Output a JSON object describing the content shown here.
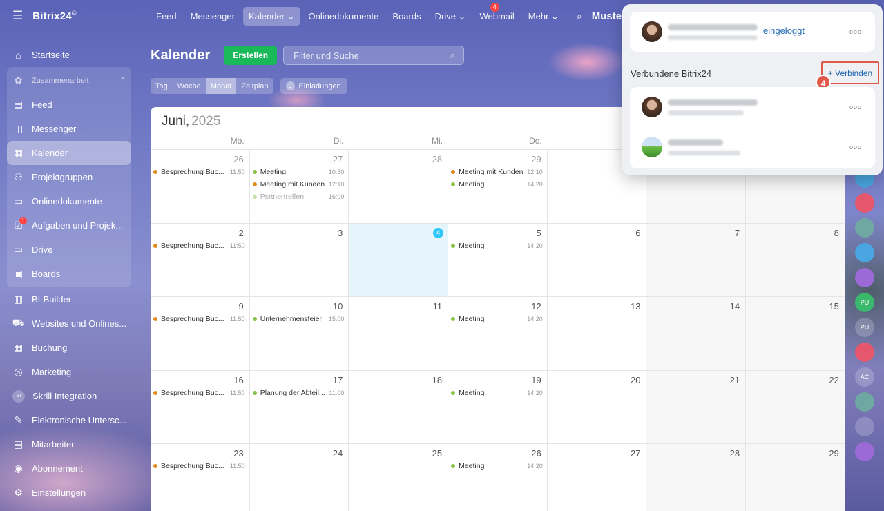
{
  "sidebar": {
    "logo": "Bitrix24",
    "logo_mark": "©",
    "items": [
      {
        "label": "Startseite",
        "icon": "home-icon"
      },
      {
        "label": "Zusammenarbeit",
        "icon": "collab-icon",
        "group_header": true
      },
      {
        "label": "Feed",
        "icon": "feed-icon"
      },
      {
        "label": "Messenger",
        "icon": "messenger-icon"
      },
      {
        "label": "Kalender",
        "icon": "calendar-icon",
        "active": true
      },
      {
        "label": "Projektgruppen",
        "icon": "groups-icon"
      },
      {
        "label": "Onlinedokumente",
        "icon": "document-icon"
      },
      {
        "label": "Aufgaben und Projek...",
        "icon": "tasks-icon",
        "badge": "1"
      },
      {
        "label": "Drive",
        "icon": "drive-icon"
      },
      {
        "label": "Boards",
        "icon": "boards-icon"
      },
      {
        "label": "BI-Builder",
        "icon": "chart-icon"
      },
      {
        "label": "Websites und Onlines...",
        "icon": "cart-icon"
      },
      {
        "label": "Buchung",
        "icon": "booking-icon"
      },
      {
        "label": "Marketing",
        "icon": "target-icon"
      },
      {
        "label": "Skrill Integration",
        "icon": "si-icon",
        "initials": "SI"
      },
      {
        "label": "Elektronische Untersc...",
        "icon": "signature-icon"
      },
      {
        "label": "Mitarbeiter",
        "icon": "employees-icon"
      },
      {
        "label": "Abonnement",
        "icon": "subscription-icon"
      },
      {
        "label": "Einstellungen",
        "icon": "gear-icon"
      }
    ]
  },
  "topbar": {
    "items": [
      {
        "label": "Feed"
      },
      {
        "label": "Messenger"
      },
      {
        "label": "Kalender ⌄",
        "active": true
      },
      {
        "label": "Onlinedokumente"
      },
      {
        "label": "Boards"
      },
      {
        "label": "Drive ⌄"
      },
      {
        "label": "Webmail",
        "badge": "4"
      },
      {
        "label": "Mehr ⌄"
      }
    ],
    "user": "Muster"
  },
  "calendar": {
    "title": "Kalender",
    "create_label": "Erstellen",
    "filter_placeholder": "Filter und Suche",
    "views": [
      "Tag",
      "Woche",
      "Monat",
      "Zeitplan"
    ],
    "active_view": "Monat",
    "invitations_count": "0",
    "invitations_label": "Einladungen",
    "month": "Juni,",
    "year": "2025",
    "weekdays": [
      "Mo.",
      "Di.",
      "Mi.",
      "Do.",
      "",
      "",
      ""
    ],
    "weeks": [
      [
        {
          "n": "26",
          "dim": true,
          "events": [
            {
              "name": "Besprechung Buc...",
              "time": "11:50",
              "color": "#e08a1e"
            }
          ]
        },
        {
          "n": "27",
          "dim": true,
          "events": [
            {
              "name": "Meeting",
              "time": "10:50",
              "color": "#8bc34a"
            },
            {
              "name": "Meeting mit Kunden",
              "time": "12:10",
              "color": "#e08a1e"
            },
            {
              "name": "Psrtnertreffen",
              "time": "16:00",
              "color": "#c5e1a5",
              "faded": true
            }
          ]
        },
        {
          "n": "28",
          "dim": true,
          "events": []
        },
        {
          "n": "29",
          "dim": true,
          "events": [
            {
              "name": "Meeting mit Kunden",
              "time": "12:10",
              "color": "#e08a1e"
            },
            {
              "name": "Meeting",
              "time": "14:20",
              "color": "#8bc34a"
            }
          ]
        },
        {
          "n": "",
          "events": []
        },
        {
          "n": "",
          "events": [],
          "weekend": true
        },
        {
          "n": "",
          "events": [],
          "weekend": true
        }
      ],
      [
        {
          "n": "2",
          "events": [
            {
              "name": "Besprechung Buc...",
              "time": "11:50",
              "color": "#e08a1e"
            }
          ]
        },
        {
          "n": "3",
          "events": []
        },
        {
          "n": "4",
          "events": [],
          "today": true
        },
        {
          "n": "5",
          "events": [
            {
              "name": "Meeting",
              "time": "14:20",
              "color": "#8bc34a"
            }
          ]
        },
        {
          "n": "6",
          "events": []
        },
        {
          "n": "7",
          "events": [],
          "weekend": true
        },
        {
          "n": "8",
          "events": [],
          "weekend": true
        }
      ],
      [
        {
          "n": "9",
          "events": [
            {
              "name": "Besprechung Buc...",
              "time": "11:50",
              "color": "#e08a1e"
            }
          ]
        },
        {
          "n": "10",
          "events": [
            {
              "name": "Unternehmensfeier",
              "time": "15:00",
              "color": "#8bc34a"
            }
          ]
        },
        {
          "n": "11",
          "events": []
        },
        {
          "n": "12",
          "events": [
            {
              "name": "Meeting",
              "time": "14:20",
              "color": "#8bc34a"
            }
          ]
        },
        {
          "n": "13",
          "events": []
        },
        {
          "n": "14",
          "events": [],
          "weekend": true
        },
        {
          "n": "15",
          "events": [],
          "weekend": true
        }
      ],
      [
        {
          "n": "16",
          "events": [
            {
              "name": "Besprechung Buc...",
              "time": "11:50",
              "color": "#e08a1e"
            }
          ]
        },
        {
          "n": "17",
          "events": [
            {
              "name": "Planung der Abteil...",
              "time": "11:00",
              "color": "#8bc34a"
            }
          ]
        },
        {
          "n": "18",
          "events": []
        },
        {
          "n": "19",
          "events": [
            {
              "name": "Meeting",
              "time": "14:20",
              "color": "#8bc34a"
            }
          ]
        },
        {
          "n": "20",
          "events": []
        },
        {
          "n": "21",
          "events": [],
          "weekend": true
        },
        {
          "n": "22",
          "events": [],
          "weekend": true
        }
      ],
      [
        {
          "n": "23",
          "events": [
            {
              "name": "Besprechung Buc...",
              "time": "11:50",
              "color": "#e08a1e"
            }
          ]
        },
        {
          "n": "24",
          "events": []
        },
        {
          "n": "25",
          "events": []
        },
        {
          "n": "26",
          "events": [
            {
              "name": "Meeting",
              "time": "14:20",
              "color": "#8bc34a"
            }
          ]
        },
        {
          "n": "27",
          "events": []
        },
        {
          "n": "28",
          "events": [],
          "weekend": true
        },
        {
          "n": "29",
          "events": [],
          "weekend": true
        }
      ]
    ]
  },
  "popup": {
    "logged_in_label": "eingeloggt",
    "connected_label": "Verbundene Bitrix24",
    "connect_button": "+ Verbinden",
    "step_number": "4",
    "more_glyph": "ooo"
  },
  "rail": [
    "",
    "",
    "",
    "",
    "",
    "PU",
    "PU",
    "",
    "AC",
    "",
    "",
    ""
  ],
  "colors": {
    "accent": "#2067b0",
    "create_button": "#19b859",
    "highlight": "#e05a4a",
    "today": "#2fc7f7"
  }
}
